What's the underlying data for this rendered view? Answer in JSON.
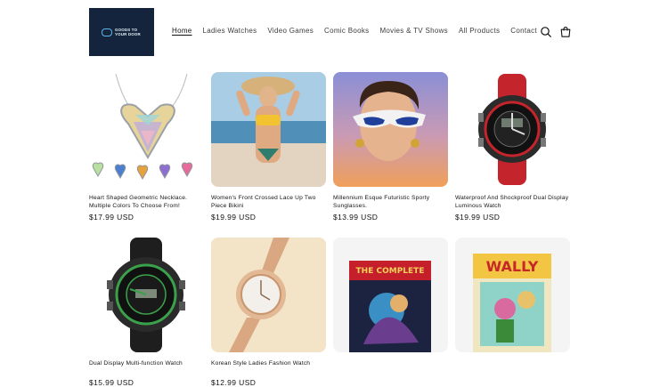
{
  "header": {
    "logo_text": "GOODS TO\nYOUR DOOR",
    "nav": [
      "Home",
      "Ladies Watches",
      "Video Games",
      "Comic Books",
      "Movies & TV Shows",
      "All Products",
      "Contact"
    ],
    "active_nav": "Home",
    "icons": [
      "search-icon",
      "cart-icon"
    ]
  },
  "products": [
    {
      "title": "Heart Shaped Geometric Necklace. Multiple Colors To Choose From!",
      "price": "$17.99 USD",
      "image": "necklace"
    },
    {
      "title": "Women's Front Crossed Lace Up Two Piece Bikini",
      "price": "$19.99 USD",
      "image": "bikini"
    },
    {
      "title": "Millennium Esque Futuristic Sporty Sunglasses.",
      "price": "$13.99 USD",
      "image": "sunglasses"
    },
    {
      "title": "Waterproof And Shockproof Dual Display Luminous Watch",
      "price": "$19.99 USD",
      "image": "red-watch"
    },
    {
      "title": "Dual Display Multi-function Watch",
      "price": "$15.99 USD",
      "image": "green-watch"
    },
    {
      "title": "Korean Style Ladies Fashion Watch",
      "price": "$12.99 USD",
      "image": "gold-watch"
    },
    {
      "title": "",
      "price": "",
      "image": "comic-book",
      "cover_text": "THE COMPLETE"
    },
    {
      "title": "",
      "price": "",
      "image": "comic-book",
      "cover_text": "WALLY"
    }
  ],
  "colors": {
    "logo_bg": "#14243c",
    "text": "#121212",
    "nav": "#3d3d3d"
  }
}
